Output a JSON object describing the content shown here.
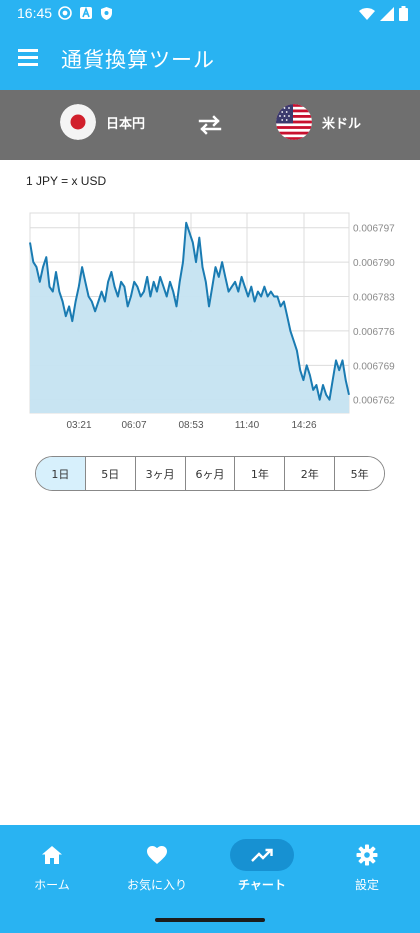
{
  "status_bar": {
    "time": "16:45",
    "icons_left": [
      "app-notification-icon",
      "text-a-icon",
      "shield-icon"
    ],
    "icons_right": [
      "wifi-icon",
      "signal-icon",
      "battery-icon"
    ]
  },
  "app_bar": {
    "title": "通貨換算ツール",
    "menu_icon": "menu-icon"
  },
  "currency_bar": {
    "from_label": "日本円",
    "to_label": "米ドル",
    "swap_icon": "swap-arrows-icon"
  },
  "rate_label": "1 JPY = x USD",
  "chart_data": {
    "type": "area",
    "title": "",
    "xlabel": "",
    "ylabel": "",
    "x_ticks": [
      "03:21",
      "06:07",
      "08:53",
      "11:40",
      "14:26"
    ],
    "y_ticks": [
      "0.006797",
      "0.006790",
      "0.006783",
      "0.006776",
      "0.006769",
      "0.006762"
    ],
    "ylim": [
      0.0067593,
      0.0068
    ],
    "grid": true,
    "color": "#1a7bb2",
    "fill": "#c5e3f1",
    "series": [
      {
        "values": [
          0.006794,
          0.00679,
          0.006789,
          0.006786,
          0.006789,
          0.006791,
          0.006785,
          0.006784,
          0.006788,
          0.006784,
          0.006782,
          0.006779,
          0.006781,
          0.006778,
          0.006782,
          0.006785,
          0.006789,
          0.006786,
          0.006783,
          0.006782,
          0.00678,
          0.006782,
          0.006784,
          0.006782,
          0.006786,
          0.006788,
          0.006785,
          0.006783,
          0.006786,
          0.006785,
          0.006781,
          0.006783,
          0.006786,
          0.006785,
          0.006783,
          0.006784,
          0.006787,
          0.006783,
          0.006786,
          0.006784,
          0.006787,
          0.006785,
          0.006783,
          0.006786,
          0.006784,
          0.006781,
          0.006786,
          0.00679,
          0.006798,
          0.006796,
          0.006794,
          0.00679,
          0.006795,
          0.006789,
          0.006786,
          0.006781,
          0.006785,
          0.006789,
          0.006787,
          0.00679,
          0.006787,
          0.006784,
          0.006785,
          0.006786,
          0.006784,
          0.006787,
          0.006785,
          0.006783,
          0.006785,
          0.006782,
          0.006784,
          0.006783,
          0.006785,
          0.006783,
          0.006784,
          0.006783,
          0.006783,
          0.006781,
          0.006782,
          0.006779,
          0.006776,
          0.006774,
          0.006772,
          0.006768,
          0.006766,
          0.006769,
          0.006767,
          0.006764,
          0.006765,
          0.006762,
          0.006765,
          0.006763,
          0.006762,
          0.006766,
          0.00677,
          0.006768,
          0.00677,
          0.006766,
          0.006763
        ]
      }
    ]
  },
  "range_selector": {
    "options": [
      "1日",
      "5日",
      "3ヶ月",
      "6ヶ月",
      "1年",
      "2年",
      "5年"
    ],
    "selected": "1日"
  },
  "bottom_nav": {
    "items": [
      {
        "label": "ホーム",
        "icon": "home-icon"
      },
      {
        "label": "お気に入り",
        "icon": "heart-icon"
      },
      {
        "label": "チャート",
        "icon": "trending-up-icon",
        "active": true
      },
      {
        "label": "設定",
        "icon": "gear-icon"
      }
    ]
  },
  "colors": {
    "primary": "#29b3f2",
    "currency_bar": "#6f6f6f",
    "active_nav_pill": "#1791d2",
    "range_selected": "#d7f0fc"
  }
}
